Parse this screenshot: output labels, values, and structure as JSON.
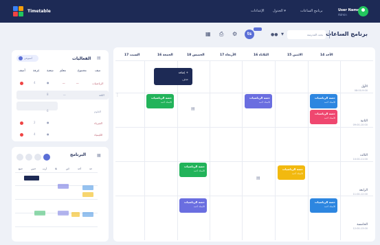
{
  "app": {
    "brand": "Timetable",
    "nav": [
      "برنامج الساعات",
      "الجدول ▾",
      "الإعدادات"
    ],
    "user_name": "User Name",
    "user_sub": "Admin",
    "page_title": "برنامج الساعات",
    "search_placeholder": "بحث المدرسة",
    "zoom": "▾",
    "badge_label": "ts"
  },
  "calendar": {
    "days": [
      "14 الأحد",
      "15 الاثنين",
      "16 الثلاثاء",
      "17 الأربعاء",
      "18 الخميس",
      "16 الجمعة",
      "17 السبت"
    ],
    "slots": [
      {
        "name": "الأول",
        "time": "08:00-9:00"
      },
      {
        "name": "الثانية",
        "time": "09:00-10:00"
      },
      {
        "name": "الثالث",
        "time": "10:00-11:00"
      },
      {
        "name": "الرابعة",
        "time": "11:00-12:00"
      },
      {
        "name": "الخامسة",
        "time": "12:00-13:00"
      }
    ],
    "event_title": "حصة الرياضيات",
    "event_sub": "الأستاذ: أحمد",
    "popup_add": "إضافة +",
    "popup_delete": "حذف"
  },
  "activities": {
    "title": "الفعاليات",
    "toggle": "أسبوعي",
    "columns": [
      "صف",
      "مجموع",
      "معلم",
      "شعبة",
      "غرفة",
      "أضف"
    ],
    "rows": [
      {
        "name": "الرياضيات",
        "count": "4"
      },
      {
        "name": "اللغة",
        "count": "8"
      },
      {
        "name": "العلوم",
        "count": "6"
      },
      {
        "name": "الفيزياء",
        "count": "2"
      },
      {
        "name": "الكيمياء",
        "count": "4"
      }
    ]
  },
  "mini": {
    "title": "البرنامج",
    "cols": [
      "حد",
      "أحد",
      "اثن",
      "ثلا",
      "أرب",
      "خمي",
      "جمع"
    ]
  }
}
